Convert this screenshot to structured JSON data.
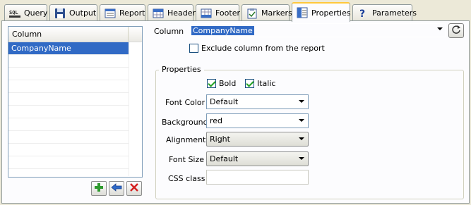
{
  "tabs": [
    {
      "label": "Query",
      "icon": "sql-icon"
    },
    {
      "label": "Output",
      "icon": "floppy-disk-icon"
    },
    {
      "label": "Report",
      "icon": "report-icon"
    },
    {
      "label": "Header",
      "icon": "header-grid-icon"
    },
    {
      "label": "Footer",
      "icon": "footer-grid-icon"
    },
    {
      "label": "Markers",
      "icon": "clipboard-check-icon"
    },
    {
      "label": "Properties",
      "icon": "properties-icon",
      "active": true
    },
    {
      "label": "Parameters",
      "icon": "question-icon"
    }
  ],
  "tab_icon_text": {
    "sql": "SQL"
  },
  "column_list": {
    "header": "Column",
    "rows": [
      "CompanyName"
    ],
    "selected_index": 0
  },
  "list_buttons": {
    "add": "add-icon",
    "back": "back-arrow-icon",
    "delete": "delete-icon"
  },
  "column_field": {
    "label": "Column",
    "value": "CompanyName"
  },
  "exclude": {
    "label": "Exclude column from the report",
    "checked": false
  },
  "properties": {
    "title": "Properties",
    "bold": {
      "label": "Bold",
      "checked": true
    },
    "italic": {
      "label": "Italic",
      "checked": true
    },
    "font_color": {
      "label": "Font Color",
      "value": "Default"
    },
    "background": {
      "label": "Background",
      "value": "red"
    },
    "alignment": {
      "label": "Alignment",
      "value": "Right"
    },
    "font_size": {
      "label": "Font Size",
      "value": "Default"
    },
    "css_class": {
      "label": "CSS class",
      "value": ""
    }
  },
  "colors": {
    "selection": "#316AC5",
    "active_tab_accent": "#FFC83C",
    "window_bg": "#ECE9D8"
  }
}
